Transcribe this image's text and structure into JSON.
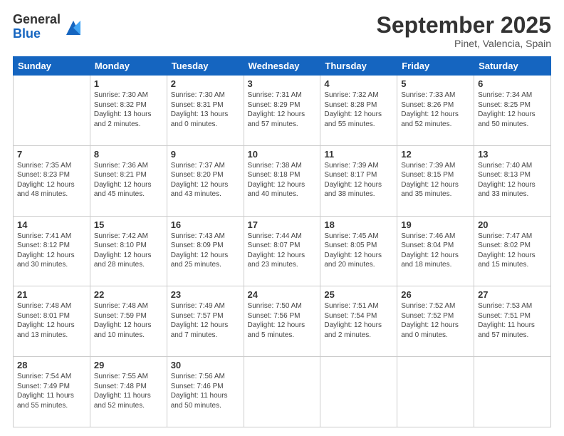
{
  "logo": {
    "general": "General",
    "blue": "Blue"
  },
  "title": "September 2025",
  "subtitle": "Pinet, Valencia, Spain",
  "days": [
    "Sunday",
    "Monday",
    "Tuesday",
    "Wednesday",
    "Thursday",
    "Friday",
    "Saturday"
  ],
  "weeks": [
    [
      {
        "day": null,
        "info": null
      },
      {
        "day": "1",
        "info": "Sunrise: 7:30 AM\nSunset: 8:32 PM\nDaylight: 13 hours\nand 2 minutes."
      },
      {
        "day": "2",
        "info": "Sunrise: 7:30 AM\nSunset: 8:31 PM\nDaylight: 13 hours\nand 0 minutes."
      },
      {
        "day": "3",
        "info": "Sunrise: 7:31 AM\nSunset: 8:29 PM\nDaylight: 12 hours\nand 57 minutes."
      },
      {
        "day": "4",
        "info": "Sunrise: 7:32 AM\nSunset: 8:28 PM\nDaylight: 12 hours\nand 55 minutes."
      },
      {
        "day": "5",
        "info": "Sunrise: 7:33 AM\nSunset: 8:26 PM\nDaylight: 12 hours\nand 52 minutes."
      },
      {
        "day": "6",
        "info": "Sunrise: 7:34 AM\nSunset: 8:25 PM\nDaylight: 12 hours\nand 50 minutes."
      }
    ],
    [
      {
        "day": "7",
        "info": "Sunrise: 7:35 AM\nSunset: 8:23 PM\nDaylight: 12 hours\nand 48 minutes."
      },
      {
        "day": "8",
        "info": "Sunrise: 7:36 AM\nSunset: 8:21 PM\nDaylight: 12 hours\nand 45 minutes."
      },
      {
        "day": "9",
        "info": "Sunrise: 7:37 AM\nSunset: 8:20 PM\nDaylight: 12 hours\nand 43 minutes."
      },
      {
        "day": "10",
        "info": "Sunrise: 7:38 AM\nSunset: 8:18 PM\nDaylight: 12 hours\nand 40 minutes."
      },
      {
        "day": "11",
        "info": "Sunrise: 7:39 AM\nSunset: 8:17 PM\nDaylight: 12 hours\nand 38 minutes."
      },
      {
        "day": "12",
        "info": "Sunrise: 7:39 AM\nSunset: 8:15 PM\nDaylight: 12 hours\nand 35 minutes."
      },
      {
        "day": "13",
        "info": "Sunrise: 7:40 AM\nSunset: 8:13 PM\nDaylight: 12 hours\nand 33 minutes."
      }
    ],
    [
      {
        "day": "14",
        "info": "Sunrise: 7:41 AM\nSunset: 8:12 PM\nDaylight: 12 hours\nand 30 minutes."
      },
      {
        "day": "15",
        "info": "Sunrise: 7:42 AM\nSunset: 8:10 PM\nDaylight: 12 hours\nand 28 minutes."
      },
      {
        "day": "16",
        "info": "Sunrise: 7:43 AM\nSunset: 8:09 PM\nDaylight: 12 hours\nand 25 minutes."
      },
      {
        "day": "17",
        "info": "Sunrise: 7:44 AM\nSunset: 8:07 PM\nDaylight: 12 hours\nand 23 minutes."
      },
      {
        "day": "18",
        "info": "Sunrise: 7:45 AM\nSunset: 8:05 PM\nDaylight: 12 hours\nand 20 minutes."
      },
      {
        "day": "19",
        "info": "Sunrise: 7:46 AM\nSunset: 8:04 PM\nDaylight: 12 hours\nand 18 minutes."
      },
      {
        "day": "20",
        "info": "Sunrise: 7:47 AM\nSunset: 8:02 PM\nDaylight: 12 hours\nand 15 minutes."
      }
    ],
    [
      {
        "day": "21",
        "info": "Sunrise: 7:48 AM\nSunset: 8:01 PM\nDaylight: 12 hours\nand 13 minutes."
      },
      {
        "day": "22",
        "info": "Sunrise: 7:48 AM\nSunset: 7:59 PM\nDaylight: 12 hours\nand 10 minutes."
      },
      {
        "day": "23",
        "info": "Sunrise: 7:49 AM\nSunset: 7:57 PM\nDaylight: 12 hours\nand 7 minutes."
      },
      {
        "day": "24",
        "info": "Sunrise: 7:50 AM\nSunset: 7:56 PM\nDaylight: 12 hours\nand 5 minutes."
      },
      {
        "day": "25",
        "info": "Sunrise: 7:51 AM\nSunset: 7:54 PM\nDaylight: 12 hours\nand 2 minutes."
      },
      {
        "day": "26",
        "info": "Sunrise: 7:52 AM\nSunset: 7:52 PM\nDaylight: 12 hours\nand 0 minutes."
      },
      {
        "day": "27",
        "info": "Sunrise: 7:53 AM\nSunset: 7:51 PM\nDaylight: 11 hours\nand 57 minutes."
      }
    ],
    [
      {
        "day": "28",
        "info": "Sunrise: 7:54 AM\nSunset: 7:49 PM\nDaylight: 11 hours\nand 55 minutes."
      },
      {
        "day": "29",
        "info": "Sunrise: 7:55 AM\nSunset: 7:48 PM\nDaylight: 11 hours\nand 52 minutes."
      },
      {
        "day": "30",
        "info": "Sunrise: 7:56 AM\nSunset: 7:46 PM\nDaylight: 11 hours\nand 50 minutes."
      },
      {
        "day": null,
        "info": null
      },
      {
        "day": null,
        "info": null
      },
      {
        "day": null,
        "info": null
      },
      {
        "day": null,
        "info": null
      }
    ]
  ]
}
